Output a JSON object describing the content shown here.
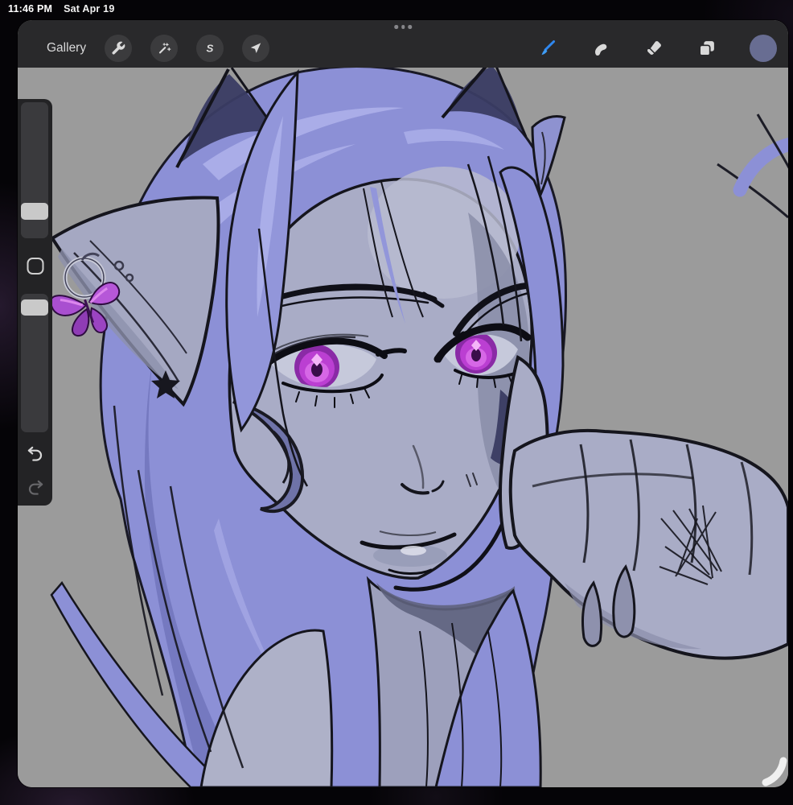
{
  "status_bar": {
    "time": "11:46 PM",
    "date": "Sat Apr 19"
  },
  "window": {
    "drag_handle_icon": "ellipsis-icon",
    "toolbar": {
      "gallery_label": "Gallery",
      "left_tools": [
        {
          "name": "actions",
          "icon": "wrench-icon"
        },
        {
          "name": "adjustments",
          "icon": "magic-wand-icon"
        },
        {
          "name": "selection",
          "icon": "selection-s-icon"
        },
        {
          "name": "transform",
          "icon": "transform-arrow-icon"
        }
      ],
      "right_tools": [
        {
          "name": "paint",
          "icon": "brush-icon",
          "active": true
        },
        {
          "name": "smudge",
          "icon": "smudge-finger-icon",
          "active": false
        },
        {
          "name": "erase",
          "icon": "eraser-icon",
          "active": false
        },
        {
          "name": "layers",
          "icon": "layers-icon",
          "active": false
        },
        {
          "name": "color",
          "icon": "color-swatch",
          "active": false
        }
      ]
    }
  },
  "sidebar": {
    "controls": [
      "brush-size-slider",
      "modify-button",
      "opacity-slider",
      "undo-button",
      "redo-button"
    ]
  },
  "canvas": {
    "artwork_description": "Digital painting: periwinkle-haired character with cat ears, pointed elf ears, magenta eyes, butterfly hoop earring, star mark, crescent cheek swirl, hand with long nails resting against cheek on gray background"
  },
  "colors": {
    "accent_blue": "#2f87ef",
    "color_swatch": "#686d92",
    "toolbar_bg": "#29292b",
    "button_bg": "#3b3b3d",
    "icon": "#d9d9d9",
    "canvas_bg": "#9b9b9b",
    "sidebar_bg": "#232325",
    "track_bg": "#3a3a3d",
    "handle_bg": "#c9c9c9",
    "hair": "#8c90d6",
    "hair_highlight": "#adb0ea",
    "hair_shadow": "#6e72b8",
    "skin": "#a9acc6",
    "skin_shadow": "#898da8",
    "line": "#15151d",
    "iris": "#bb3fd2",
    "butterfly": "#a94fd0",
    "status_text": "#ffffff"
  }
}
